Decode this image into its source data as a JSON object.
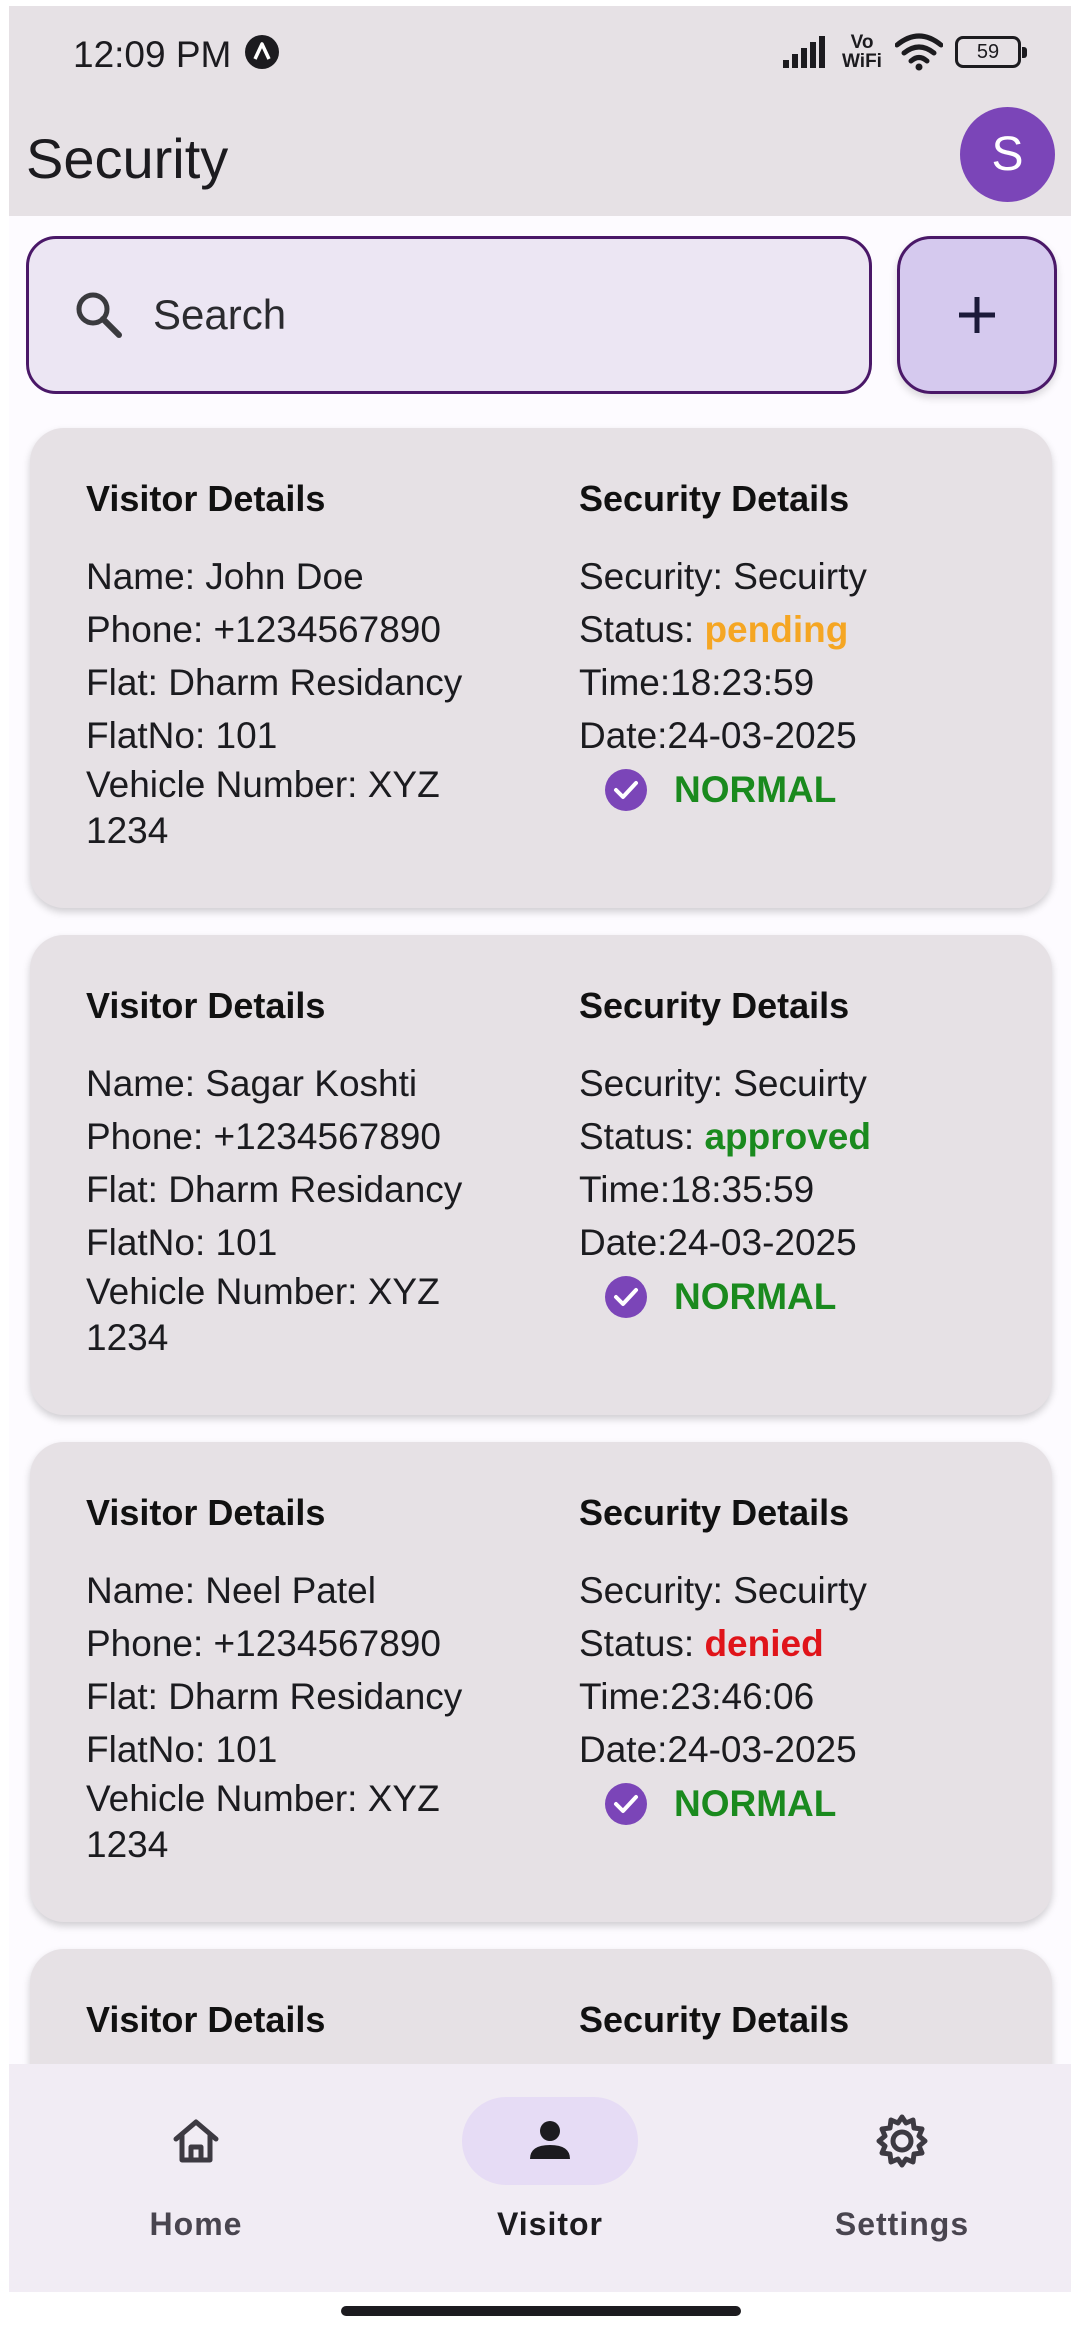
{
  "status_bar": {
    "time": "12:09 PM",
    "network_label_top": "Vo",
    "network_label_bottom": "WiFi",
    "battery": "59"
  },
  "app_bar": {
    "title": "Security",
    "avatar_letter": "S"
  },
  "search": {
    "placeholder": "Search"
  },
  "colors": {
    "pending": "#f5a623",
    "approved": "#1a8a1e",
    "denied": "#e0141a",
    "accent": "#7b45b8"
  },
  "cards": [
    {
      "visitor_heading": "Visitor Details",
      "name": "Name: John Doe",
      "phone": "Phone: +1234567890",
      "flat": "Flat: Dharm Residancy",
      "flat_no": "FlatNo: 101",
      "vehicle_line1": "Vehicle Number: XYZ",
      "vehicle_line2": "1234",
      "security_heading": "Security Details",
      "security": "Security: Secuirty",
      "status_label": "Status: ",
      "status_value": "pending",
      "time": "Time:18:23:59",
      "date": "Date:24-03-2025",
      "type": "NORMAL"
    },
    {
      "visitor_heading": "Visitor Details",
      "name": "Name: Sagar Koshti",
      "phone": "Phone: +1234567890",
      "flat": "Flat: Dharm Residancy",
      "flat_no": "FlatNo: 101",
      "vehicle_line1": "Vehicle Number: XYZ",
      "vehicle_line2": "1234",
      "security_heading": "Security Details",
      "security": "Security: Secuirty",
      "status_label": "Status: ",
      "status_value": "approved",
      "time": "Time:18:35:59",
      "date": "Date:24-03-2025",
      "type": "NORMAL"
    },
    {
      "visitor_heading": "Visitor Details",
      "name": "Name: Neel Patel",
      "phone": "Phone: +1234567890",
      "flat": "Flat: Dharm Residancy",
      "flat_no": "FlatNo: 101",
      "vehicle_line1": "Vehicle Number: XYZ",
      "vehicle_line2": "1234",
      "security_heading": "Security Details",
      "security": "Security: Secuirty",
      "status_label": "Status: ",
      "status_value": "denied",
      "time": "Time:23:46:06",
      "date": "Date:24-03-2025",
      "type": "NORMAL"
    },
    {
      "visitor_heading": "Visitor Details",
      "security_heading": "Security Details"
    }
  ],
  "bottom_nav": {
    "items": [
      {
        "label": "Home",
        "icon": "home-icon",
        "active": false
      },
      {
        "label": "Visitor",
        "icon": "person-icon",
        "active": true
      },
      {
        "label": "Settings",
        "icon": "gear-icon",
        "active": false
      }
    ]
  }
}
